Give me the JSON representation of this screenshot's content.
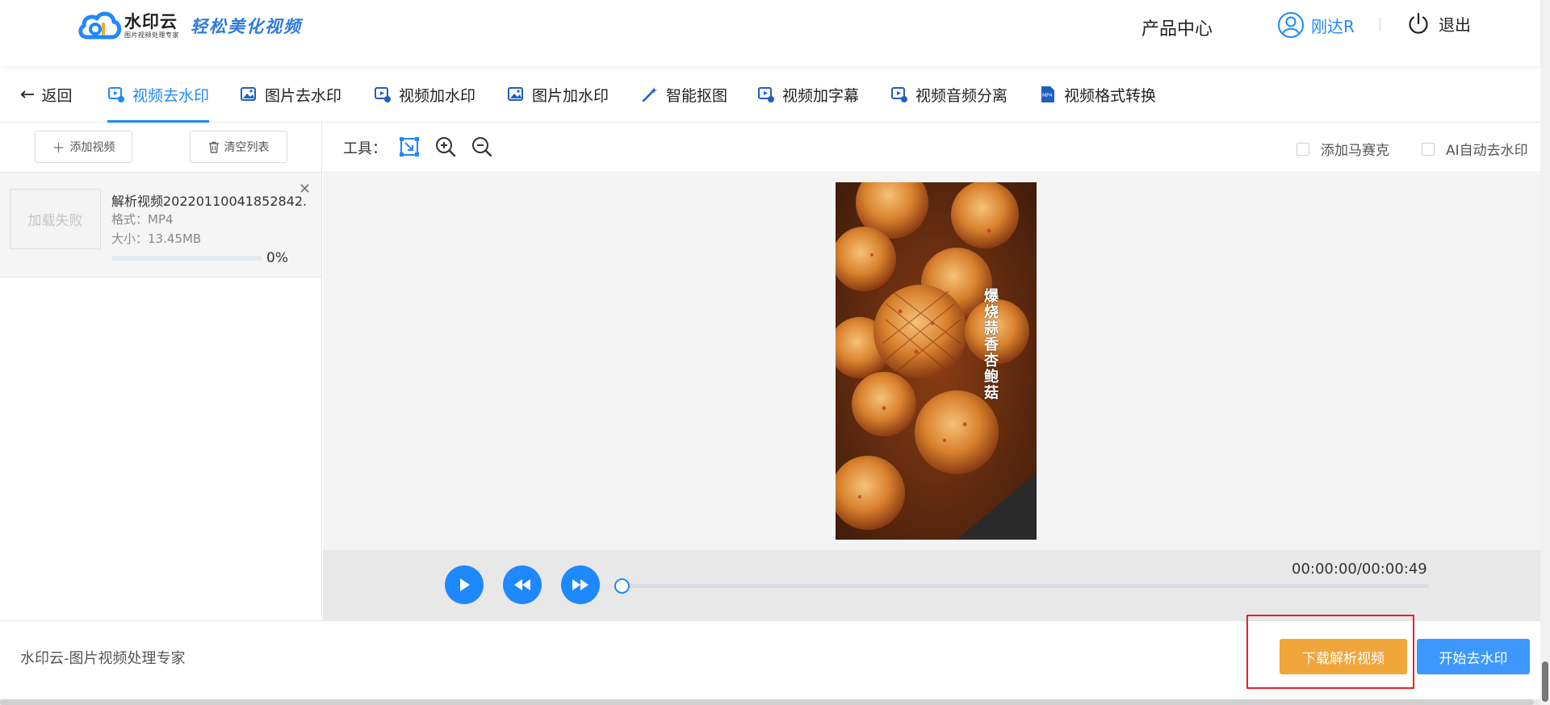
{
  "header": {
    "logo_name": "水印云",
    "logo_sub": "图片视频处理专家",
    "slogan": "轻松美化视频",
    "product_center": "产品中心",
    "user_name": "刚达R",
    "logout": "退出"
  },
  "tabs": {
    "back": "返回",
    "items": [
      {
        "label": "视频去水印",
        "active": true,
        "icon": "video-icon"
      },
      {
        "label": "图片去水印",
        "icon": "image-icon"
      },
      {
        "label": "视频加水印",
        "icon": "video-icon"
      },
      {
        "label": "图片加水印",
        "icon": "image-icon"
      },
      {
        "label": "智能抠图",
        "icon": "magic-wand-icon"
      },
      {
        "label": "视频加字幕",
        "icon": "video-icon"
      },
      {
        "label": "视频音频分离",
        "icon": "video-icon"
      },
      {
        "label": "视频格式转换",
        "icon": "mp4-file-icon"
      }
    ]
  },
  "left_panel": {
    "add_video": "添加视频",
    "clear_list": "清空列表",
    "file": {
      "thumb_status": "加载失败",
      "name": "解析视频20220110041852842...",
      "format": "格式：MP4",
      "size": "大小：13.45MB",
      "progress_percent": 0,
      "progress_text": "0%"
    }
  },
  "toolbar": {
    "tools_label": "工具：",
    "add_mosaic": "添加马赛克",
    "ai_auto_remove": "AI自动去水印",
    "add_mosaic_checked": false,
    "ai_auto_remove_checked": false
  },
  "video": {
    "caption": "爆烧蒜香杏鲍菇"
  },
  "player": {
    "time": "00:00:00/00:00:49",
    "progress": 0
  },
  "footer": {
    "text": "水印云-图片视频处理专家",
    "download_button": "下载解析视频",
    "start_button": "开始去水印"
  },
  "colors": {
    "accent": "#1e88ff",
    "download": "#f0a63a",
    "start": "#3d97ff",
    "highlight": "#e8202b"
  }
}
